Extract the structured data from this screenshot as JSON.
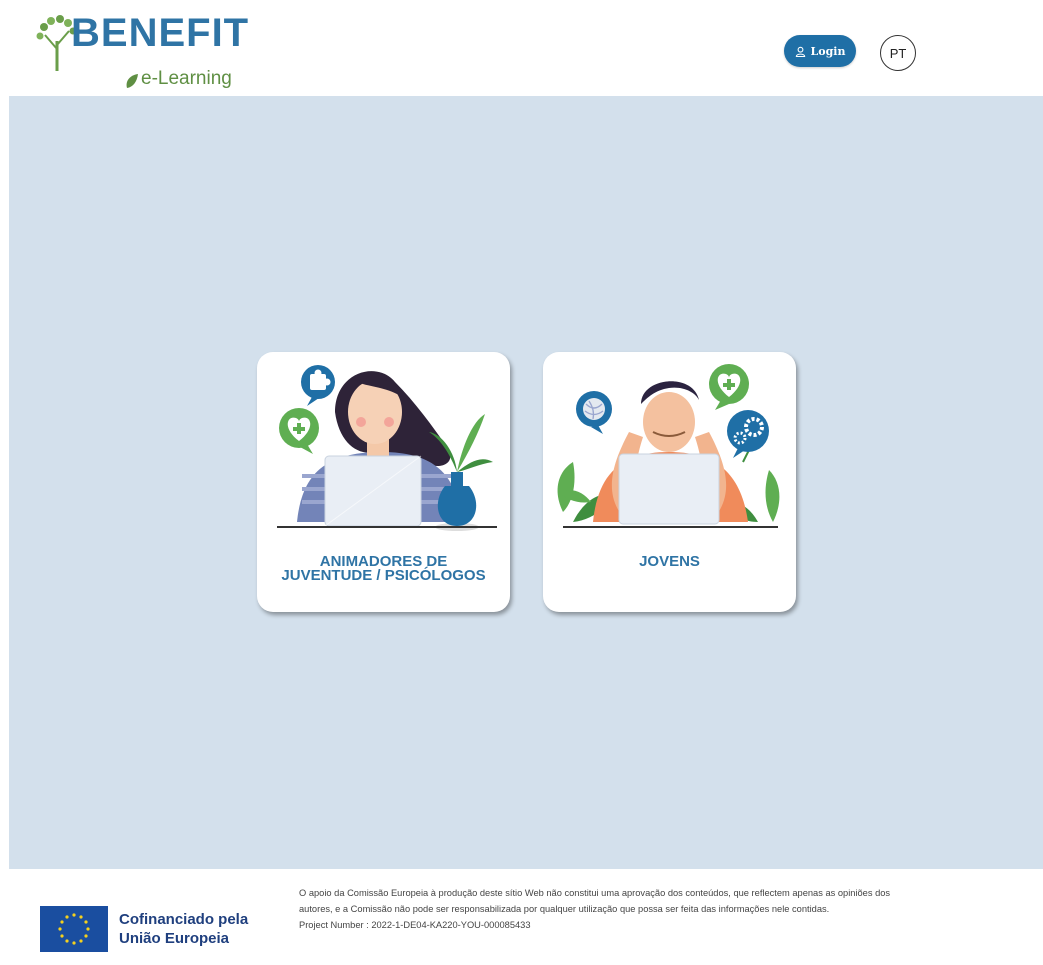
{
  "header": {
    "logo_title": "BENEFIT",
    "logo_subtitle": "e-Learning",
    "login_label": "Login",
    "language": "PT"
  },
  "cards": [
    {
      "label_line1": "ANIMADORES DE",
      "label_line2": "JUVENTUDE / PSICÓLOGOS"
    },
    {
      "label_line1": "JOVENS"
    }
  ],
  "footer": {
    "eu_line1": "Cofinanciado pela",
    "eu_line2": "União Europeia",
    "disclaimer_line1": "O apoio da Comissão Europeia à produção deste sítio Web não constitui uma aprovação dos conteúdos, que reflectem apenas as opiniões dos",
    "disclaimer_line2": "autores, e a Comissão não pode ser responsabilizada por qualquer utilização que possa ser feita das informações nele contidas.",
    "project_number": "Project Number : 2022-1-DE04-KA220-YOU-000085433"
  },
  "colors": {
    "brand_blue": "#2f74a5",
    "brand_green": "#5f8f43",
    "button_blue": "#1f6fa6",
    "content_bg": "#d3e0ec",
    "eu_blue": "#1a4ea0",
    "eu_star": "#f6d11d"
  },
  "icons": [
    "tree-leaf-logo-icon",
    "leaf-icon",
    "user-icon",
    "puzzle-icon",
    "heart-plus-icon",
    "yarn-ball-icon",
    "gears-icon",
    "eu-flag-icon"
  ]
}
